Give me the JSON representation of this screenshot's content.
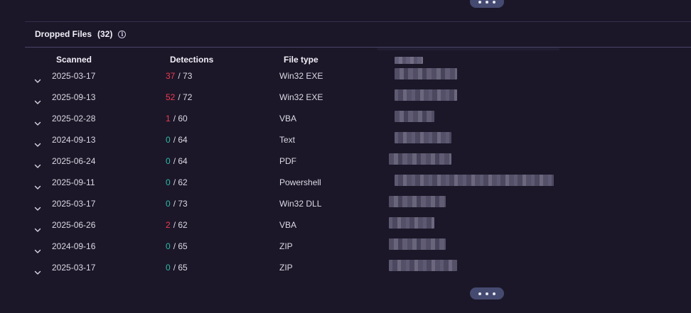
{
  "pagination": {
    "more_label": "..."
  },
  "section": {
    "title": "Dropped Files",
    "count": "(32)",
    "info_glyph": "i"
  },
  "columns": {
    "scanned": "Scanned",
    "detections": "Detections",
    "file_type": "File type"
  },
  "rows": [
    {
      "scanned": "2025-03-17",
      "detected": "37",
      "total": "/ 73",
      "file_type": "Win32 EXE",
      "flagged": true
    },
    {
      "scanned": "2025-09-13",
      "detected": "52",
      "total": "/ 72",
      "file_type": "Win32 EXE",
      "flagged": true
    },
    {
      "scanned": "2025-02-28",
      "detected": "1",
      "total": "/ 60",
      "file_type": "VBA",
      "flagged": true
    },
    {
      "scanned": "2024-09-13",
      "detected": "0",
      "total": "/ 64",
      "file_type": "Text",
      "flagged": false
    },
    {
      "scanned": "2025-06-24",
      "detected": "0",
      "total": "/ 64",
      "file_type": "PDF",
      "flagged": false
    },
    {
      "scanned": "2025-09-11",
      "detected": "0",
      "total": "/ 62",
      "file_type": "Powershell",
      "flagged": false
    },
    {
      "scanned": "2025-03-17",
      "detected": "0",
      "total": "/ 73",
      "file_type": "Win32 DLL",
      "flagged": false
    },
    {
      "scanned": "2025-06-26",
      "detected": "2",
      "total": "/ 62",
      "file_type": "VBA",
      "flagged": true
    },
    {
      "scanned": "2024-09-16",
      "detected": "0",
      "total": "/ 65",
      "file_type": "ZIP",
      "flagged": false
    },
    {
      "scanned": "2025-03-17",
      "detected": "0",
      "total": "/ 65",
      "file_type": "ZIP",
      "flagged": false
    }
  ],
  "colors": {
    "background": "#1b1728",
    "detection_positive": "#f03b53",
    "detection_zero": "#2fb9a8",
    "pill": "#454a70"
  },
  "icons": {
    "expand": "chevron-down-icon",
    "info": "info-icon",
    "more": "more-dots-icon"
  }
}
